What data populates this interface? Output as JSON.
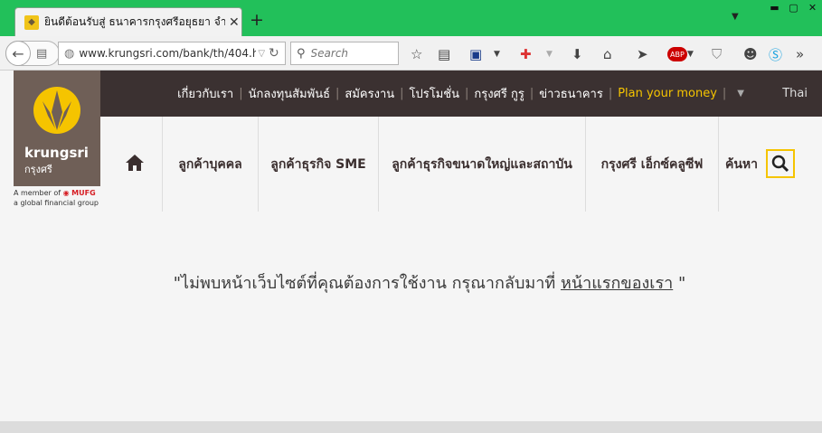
{
  "browser": {
    "tab_title": "ยินดีต้อนรับสู่ ธนาคารกรุงศรีอยุธยา จำ...",
    "new_tab_label": "+",
    "url": "www.krungsri.com/bank/th/404.h",
    "search_placeholder": "Search"
  },
  "site": {
    "brand": "krungsri",
    "brand_thai": "กรุงศรี",
    "mufg_line1": "A member of",
    "mufg_name": "MUFG",
    "mufg_line2": "a global financial group",
    "top_links": [
      "เกี่ยวกับเรา",
      "นักลงทุนสัมพันธ์",
      "สมัครงาน",
      "โปรโมชั่น",
      "กรุงศรี กูรู",
      "ข่าวธนาคาร"
    ],
    "plan_link": "Plan your money",
    "language": "Thai",
    "main_nav": [
      "ลูกค้าบุคคล",
      "ลูกค้าธุรกิจ SME",
      "ลูกค้าธุรกิจขนาดใหญ่และสถาบัน",
      "กรุงศรี เอ็กซ์คลูซีฟ"
    ],
    "search_label": "ค้นหา",
    "message_prefix": "\"ไม่พบหน้าเว็บไซต์ที่คุณต้องการใช้งาน กรุณากลับมาที่ ",
    "message_link": "หน้าแรกของเรา",
    "message_suffix": " \""
  },
  "colors": {
    "browser_green": "#22c05a",
    "header_dark": "#3b3131",
    "logo_bg": "#6f5f57",
    "accent_yellow": "#f5c400"
  }
}
